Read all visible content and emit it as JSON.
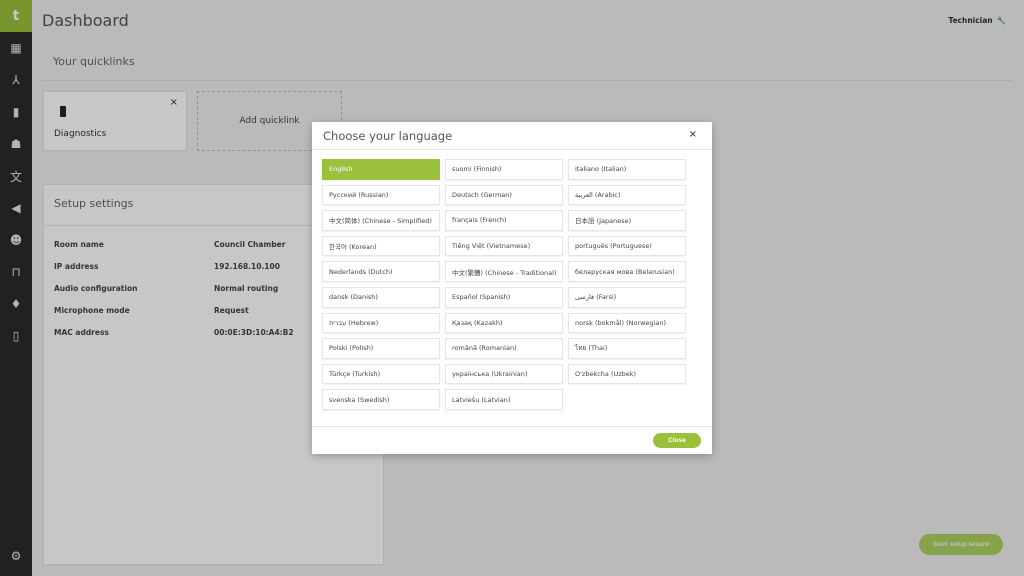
{
  "app": {
    "logo_letter": "t"
  },
  "sidebar": {
    "items": [
      {
        "icon": "dashboard-icon",
        "glyph": "▦"
      },
      {
        "icon": "network-icon",
        "glyph": "⅄"
      },
      {
        "icon": "battery-icon",
        "glyph": "▮"
      },
      {
        "icon": "users-voice-icon",
        "glyph": "☗"
      },
      {
        "icon": "translate-icon",
        "glyph": "文"
      },
      {
        "icon": "speaker-icon",
        "glyph": "◀"
      },
      {
        "icon": "people-icon",
        "glyph": "☻"
      },
      {
        "icon": "seat-icon",
        "glyph": "⊓"
      },
      {
        "icon": "microphone-icon",
        "glyph": "♦"
      },
      {
        "icon": "document-icon",
        "glyph": "▯"
      }
    ],
    "settings_icon": "⚙"
  },
  "header": {
    "title": "Dashboard",
    "user": "Technician",
    "user_icon": "🔧"
  },
  "quicklinks": {
    "title": "Your quicklinks",
    "cards": [
      {
        "label": "Diagnostics"
      }
    ],
    "add_label": "Add quicklink",
    "close_glyph": "×"
  },
  "setup": {
    "title": "Setup settings",
    "rows": [
      {
        "label": "Room name",
        "value": "Council Chamber"
      },
      {
        "label": "IP address",
        "value": "192.168.10.100"
      },
      {
        "label": "Audio configuration",
        "value": "Normal routing"
      },
      {
        "label": "Microphone mode",
        "value": "Request"
      },
      {
        "label": "MAC address",
        "value": "00:0E:3D:10:A4:B2"
      }
    ]
  },
  "wizard_button": "Start setup wizard",
  "modal": {
    "title": "Choose your language",
    "close_glyph": "×",
    "close_button": "Close",
    "selected": "English",
    "languages": [
      "English",
      "suomi (Finnish)",
      "italiano (Italian)",
      "Русский (Russian)",
      "Deutsch (German)",
      "العربية (Arabic)",
      "中文(简体) (Chinese - Simplified)",
      "français (French)",
      "日本語 (Japanese)",
      "한국어 (Korean)",
      "Tiếng Việt (Vietnamese)",
      "português (Portuguese)",
      "Nederlands (Dutch)",
      "中文(繁體) (Chinese - Traditional)",
      "беларуская мова (Belarusian)",
      "dansk (Danish)",
      "Español (Spanish)",
      "فارسی (Farsi)",
      "עברית (Hebrew)",
      "Қазақ (Kazakh)",
      "norsk (bokmål) (Norwegian)",
      "Polski (Polish)",
      "română (Romanian)",
      "ไทย (Thai)",
      "Türkçe (Turkish)",
      "українська (Ukrainian)",
      "O'zbekcha (Uzbek)",
      "svenska (Swedish)",
      "Latviešu (Latvian)"
    ]
  }
}
